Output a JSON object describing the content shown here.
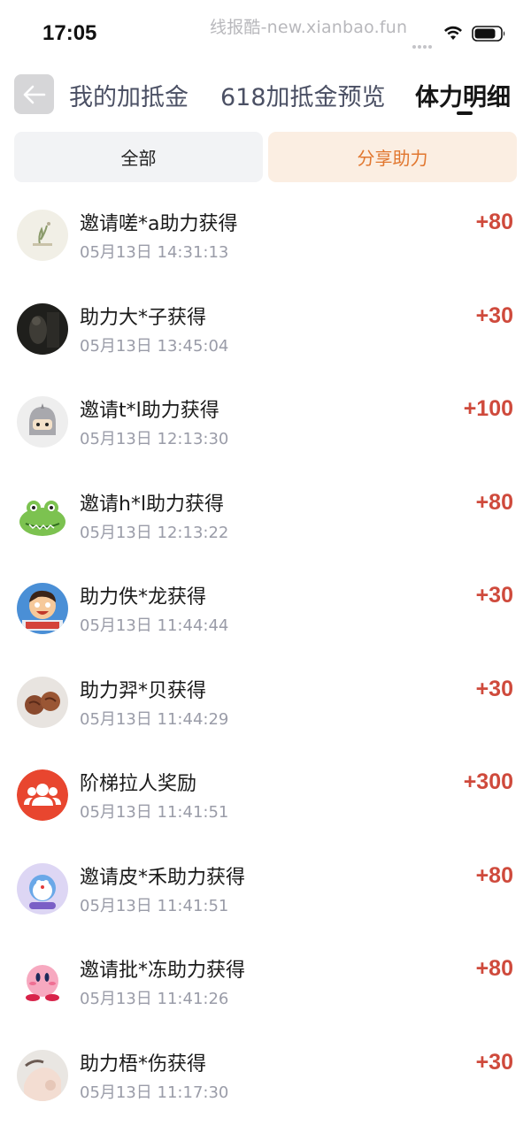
{
  "status_bar": {
    "time": "17:05",
    "watermark": "线报酷-new.xianbao.fun",
    "icons": [
      "signal-dots-icon",
      "wifi-icon",
      "battery-icon"
    ]
  },
  "nav": {
    "back_icon": "back-arrow-icon",
    "tabs": [
      {
        "label": "我的加抵金",
        "active": false
      },
      {
        "label": "618加抵金预览",
        "active": false
      },
      {
        "label": "体力明细",
        "active": true
      }
    ]
  },
  "filters": [
    {
      "label": "全部",
      "active": false
    },
    {
      "label": "分享助力",
      "active": true
    }
  ],
  "colors": {
    "amount": "#cf4a3c",
    "filter_active_bg": "#fbeee2",
    "filter_active_text": "#e1762e",
    "back_button_bg": "#d6d6d8"
  },
  "records": [
    {
      "title": "邀请嗟*a助力获得",
      "time": "05月13日 14:31:13",
      "amount": "+80",
      "avatar": "landscape-avatar"
    },
    {
      "title": "助力大*子获得",
      "time": "05月13日 13:45:04",
      "amount": "+30",
      "avatar": "dark-photo-avatar"
    },
    {
      "title": "邀请t*l助力获得",
      "time": "05月13日 12:13:30",
      "amount": "+100",
      "avatar": "ninja-avatar"
    },
    {
      "title": "邀请h*l助力获得",
      "time": "05月13日 12:13:22",
      "amount": "+80",
      "avatar": "frog-avatar"
    },
    {
      "title": "助力佚*龙获得",
      "time": "05月13日 11:44:44",
      "amount": "+30",
      "avatar": "cartoon-boy-avatar"
    },
    {
      "title": "助力羿*贝获得",
      "time": "05月13日 11:44:29",
      "amount": "+30",
      "avatar": "walnut-avatar"
    },
    {
      "title": "阶梯拉人奖励",
      "time": "05月13日 11:41:51",
      "amount": "+300",
      "avatar": "group-people-icon"
    },
    {
      "title": "邀请皮*禾助力获得",
      "time": "05月13日 11:41:51",
      "amount": "+80",
      "avatar": "doraemon-avatar"
    },
    {
      "title": "邀请批*冻助力获得",
      "time": "05月13日 11:41:26",
      "amount": "+80",
      "avatar": "kirby-avatar"
    },
    {
      "title": "助力梧*伤获得",
      "time": "05月13日 11:17:30",
      "amount": "+30",
      "avatar": "hand-photo-avatar"
    }
  ]
}
